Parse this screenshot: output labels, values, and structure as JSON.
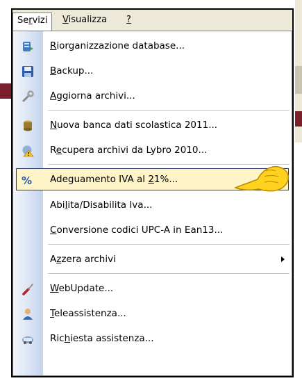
{
  "menubar": {
    "servizi": {
      "pre": "Se",
      "acc": "r",
      "post": "vizi"
    },
    "visualizza": {
      "pre": "",
      "acc": "V",
      "post": "isualizza"
    },
    "help": {
      "pre": "",
      "acc": "?",
      "post": ""
    }
  },
  "menu": {
    "items": [
      {
        "pre": "",
        "acc": "R",
        "post": "iorganizzazione database...",
        "icon": "database-reorganize-icon"
      },
      {
        "pre": "",
        "acc": "B",
        "post": "ackup...",
        "icon": "floppy-disk-icon"
      },
      {
        "pre": "",
        "acc": "A",
        "post": "ggiorna archivi...",
        "icon": "wrench-icon"
      },
      {
        "pre": "",
        "acc": "N",
        "post": "uova banca dati scolastica 2011...",
        "icon": "database-icon"
      },
      {
        "pre": "R",
        "acc": "e",
        "post": "cupera archivi da Lybro 2010...",
        "icon": "warning-recover-icon"
      },
      {
        "pre": "Adeguamento IVA al ",
        "acc": "2",
        "post": "1%...",
        "icon": "percent-icon"
      },
      {
        "pre": "Abi",
        "acc": "l",
        "post": "ita/Disabilita Iva...",
        "icon": ""
      },
      {
        "pre": "",
        "acc": "C",
        "post": "onversione codici UPC-A in Ean13...",
        "icon": ""
      },
      {
        "pre": "A",
        "acc": "z",
        "post": "zera archivi",
        "icon": "",
        "submenu": true
      },
      {
        "pre": "",
        "acc": "W",
        "post": "ebUpdate...",
        "icon": "screwdriver-icon"
      },
      {
        "pre": "",
        "acc": "T",
        "post": "eleassistenza...",
        "icon": "user-support-icon"
      },
      {
        "pre": "Ric",
        "acc": "h",
        "post": "iesta assistenza...",
        "icon": "network-help-icon"
      }
    ]
  },
  "colors": {
    "highlight_bg": "#fff4c8",
    "highlight_border": "#2c3e6a",
    "menubar_bg": "#ece9d8"
  }
}
